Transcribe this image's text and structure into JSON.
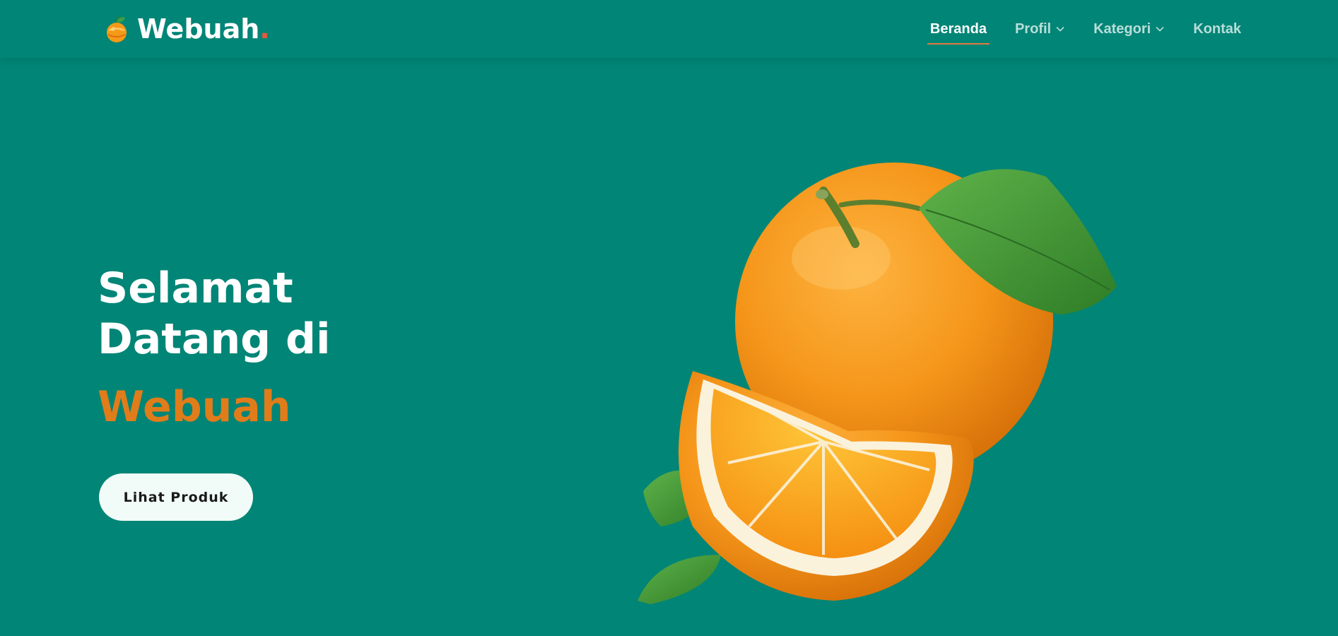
{
  "header": {
    "brand": {
      "name": "Webuah",
      "dot": ".",
      "dot_color": "#e9583a",
      "icon": "orange-fruit-icon"
    },
    "nav": {
      "items": [
        {
          "label": "Beranda",
          "active": true,
          "has_dropdown": false
        },
        {
          "label": "Profil",
          "active": false,
          "has_dropdown": true
        },
        {
          "label": "Kategori",
          "active": false,
          "has_dropdown": true
        },
        {
          "label": "Kontak",
          "active": false,
          "has_dropdown": false
        }
      ]
    }
  },
  "hero": {
    "title": "Selamat Datang di",
    "brand": "Webuah",
    "cta_label": "Lihat Produk",
    "image": "orange-fruit-with-slice-and-leaves"
  },
  "colors": {
    "background": "#018576",
    "accent": "#e07c1a",
    "nav_underline": "#e07a3e",
    "button_bg": "#f1fbf7"
  }
}
